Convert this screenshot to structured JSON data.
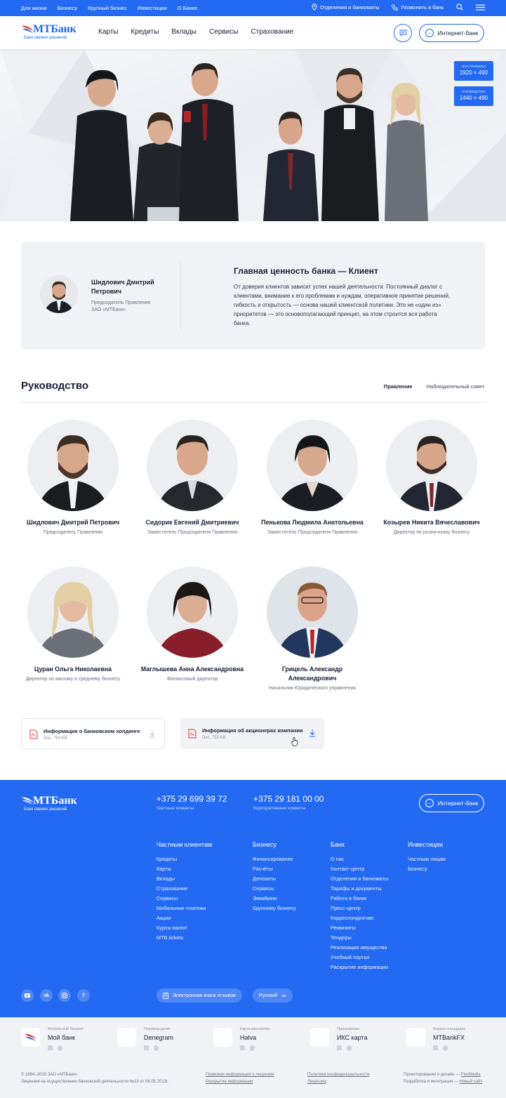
{
  "topbar": {
    "links": [
      "Для жизни",
      "Бизнесу",
      "Крупный бизнес",
      "Инвестиции",
      "О Банке"
    ],
    "branches": "Отделения и банкоматы",
    "call": "Позвонить в банк"
  },
  "header": {
    "logo": "МТБанк",
    "slogan": "Банк свежих решений",
    "menu": [
      "Карты",
      "Кредиты",
      "Вклады",
      "Сервисы",
      "Страхование"
    ],
    "internet_bank": "Интернет-банк"
  },
  "hero": {
    "badges": [
      {
        "key": "ФОН ПРОМОБЛ",
        "value": "1920 × 490"
      },
      {
        "key": "РУКОВОДСТВО",
        "value": "1440 × 490"
      }
    ]
  },
  "quote": {
    "name": "Шидлович Дмитрий Петрович",
    "role": "Председатель Правления ЗАО «МТБанк»",
    "title": "Главная ценность банка — Клиент",
    "text": "От доверия клиентов зависит успех нашей деятельности. Постоянный диалог с клиентами, внимание к его проблемам и нуждам, оперативное принятие решений, гибкость и открытость — основа нашей клиентской политики. Это не «один из» приоритетов — это основополагающий принцип, на этом строится вся работа банка."
  },
  "management": {
    "title": "Руководство",
    "tabs": [
      "Правление",
      "Наблюдательный совет"
    ],
    "people": [
      {
        "name": "Шидлович Дмитрий Петрович",
        "role": "Председатель Правления"
      },
      {
        "name": "Сидорик Евгений Дмитриевич",
        "role": "Заместитель Председателя Правления"
      },
      {
        "name": "Пенькова Людмила Анатольевна",
        "role": "Заместитель Председателя Правления"
      },
      {
        "name": "Козырев Никита Вячеславович",
        "role": "Директор по розничному бизнесу"
      },
      {
        "name": "Цуран Ольга Николаевна",
        "role": "Директор по малому и среднему бизнесу"
      },
      {
        "name": "Маглышева Анна Александровна",
        "role": "Финансовый директор"
      },
      {
        "name": "Грицель Александр Александрович",
        "role": "Начальник Юридического управления"
      }
    ]
  },
  "documents": [
    {
      "title": "Информация о банковском холдинге",
      "meta": "Doc, 753 KB"
    },
    {
      "title": "Информация об акционерах компании",
      "meta": "Doc, 753 KB"
    }
  ],
  "footer": {
    "logo": "МТБанк",
    "slogan": "Банк свежих решений",
    "phones": [
      {
        "number": "+375 29 699 39 72",
        "caption": "Частные клиенты"
      },
      {
        "number": "+375 29 181 00 00",
        "caption": "Корпоративные клиенты"
      }
    ],
    "internet_bank": "Интернет-банк",
    "columns": [
      {
        "title": "Частным клиентам",
        "items": [
          "Кредиты",
          "Карты",
          "Вклады",
          "Страхование",
          "Сервисы",
          "Мобильные платежи",
          "Акции",
          "Курсы валют",
          "MTB.tickets"
        ]
      },
      {
        "title": "Бизнесу",
        "items": [
          "Финансирование",
          "Расчёты",
          "Депозиты",
          "Сервисы",
          "Эквайринг",
          "Крупному бизнесу"
        ]
      },
      {
        "title": "Банк",
        "items": [
          "О нас",
          "Контакт-центр",
          "Отделения и банкоматы",
          "Тарифы и документы",
          "Работа в банке",
          "Пресс-центр",
          "Корреспондентам",
          "Реквизиты",
          "Тендеры",
          "Реализация имущества",
          "Учебный портал",
          "Раскрытие информации"
        ]
      },
      {
        "title": "Инвестиции",
        "items": [
          "Частным лицам",
          "Бизнесу"
        ]
      }
    ],
    "reviews": "Электронная книга отзывов",
    "language": "Русский"
  },
  "apps": [
    {
      "kind": "Мобильный банкинг",
      "name": "Мой банк"
    },
    {
      "kind": "Перевод денег",
      "name": "Denegram"
    },
    {
      "kind": "Карта рассрочки",
      "name": "Halva"
    },
    {
      "kind": "Приложение",
      "name": "ИКС карта"
    },
    {
      "kind": "Форекс-площадка",
      "name": "MTBankFX"
    }
  ],
  "legal": {
    "copyright": "© 1994–2019 ЗАО «МТБанк»",
    "license": "Лицензия на осуществление банковской деятельности №13 от 06.05.2013г.",
    "link1": "Правовая информация о лицензии",
    "link2": "Раскрытие информации",
    "link3": "Политика конфиденциальности",
    "link4": "Лицензии",
    "design_label": "Проектирование и дизайн —",
    "design_name": "FlexMedia",
    "dev_label": "Разработка и интеграция —",
    "dev_name": "Новый сайт"
  }
}
